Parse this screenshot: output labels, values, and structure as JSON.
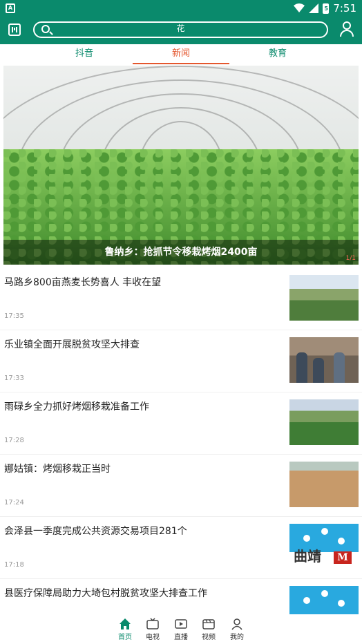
{
  "status_bar": {
    "time": "7:51",
    "battery_level_label": "5"
  },
  "header": {
    "search_value": "花"
  },
  "tabs": [
    {
      "label": "抖音"
    },
    {
      "label": "新闻"
    },
    {
      "label": "教育"
    }
  ],
  "active_tab": "新闻",
  "banner": {
    "caption": "鲁纳乡：抢抓节令移栽烤烟2400亩",
    "pager": "1/1"
  },
  "news": [
    {
      "title": "马路乡800亩燕麦长势喜人 丰收在望",
      "time": "17:35"
    },
    {
      "title": "乐业镇全面开展脱贫攻坚大排查",
      "time": "17:33"
    },
    {
      "title": "雨碌乡全力抓好烤烟移栽准备工作",
      "time": "17:28"
    },
    {
      "title": "娜姑镇：烤烟移栽正当时",
      "time": "17:24"
    },
    {
      "title": "会泽县一季度完成公共资源交易项目281个",
      "time": "17:18",
      "thumb_text": "曲靖",
      "thumb_badge": "M"
    },
    {
      "title": "县医疗保障局助力大埼包村脱贫攻坚大排查工作",
      "time": ""
    }
  ],
  "bottom_nav": [
    {
      "label": "首页"
    },
    {
      "label": "电视"
    },
    {
      "label": "直播"
    },
    {
      "label": "视频"
    },
    {
      "label": "我的"
    }
  ],
  "colors": {
    "brand": "#0a8a6c",
    "active_tab": "#e4572e"
  }
}
